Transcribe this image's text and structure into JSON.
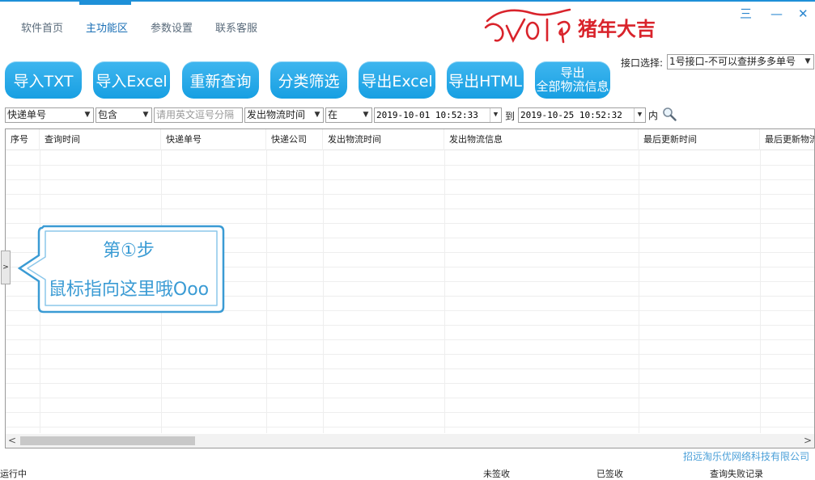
{
  "nav": {
    "items": [
      {
        "label": "软件首页"
      },
      {
        "label": "主功能区",
        "active": true
      },
      {
        "label": "参数设置"
      },
      {
        "label": "联系客服"
      }
    ]
  },
  "logo": {
    "text": "2019猪年大吉"
  },
  "window_controls": {
    "menu": "三",
    "minimize": "—",
    "close": "✕"
  },
  "toolbar": {
    "buttons": [
      "导入TXT",
      "导入Excel",
      "重新查询",
      "分类筛选",
      "导出Excel",
      "导出HTML"
    ],
    "export_all": {
      "line1": "导出",
      "line2": "全部物流信息"
    }
  },
  "api": {
    "label": "接口选择:",
    "selected": "1号接口-不可以查拼多多单号"
  },
  "filter": {
    "field": "快递单号",
    "op": "包含",
    "input_placeholder": "请用英文逗号分隔",
    "time_field": "发出物流时间",
    "time_op": "在",
    "date_from": "2019-10-01  10:52:33",
    "to_label": "到",
    "date_to": "2019-10-25  10:52:32",
    "within_label": "内"
  },
  "table": {
    "columns": [
      "序号",
      "查询时间",
      "快递单号",
      "快递公司",
      "发出物流时间",
      "发出物流信息",
      "最后更新时间",
      "最后更新物流"
    ]
  },
  "tooltip": {
    "line1": "第①步",
    "line2": "鼠标指向这里哦Ooo"
  },
  "side_tab": ">",
  "scroll": {
    "left": "<",
    "right": ">"
  },
  "footer": {
    "company": "招远淘乐优网络科技有限公司",
    "status": "运行中",
    "unsigned": "未签收",
    "signed": "已签收",
    "failed": "查询失败记录"
  },
  "colors": {
    "accent": "#1e90d8",
    "button": "#1fa7e8",
    "logo_red": "#d9232b",
    "tooltip_text": "#3a9bd4"
  }
}
